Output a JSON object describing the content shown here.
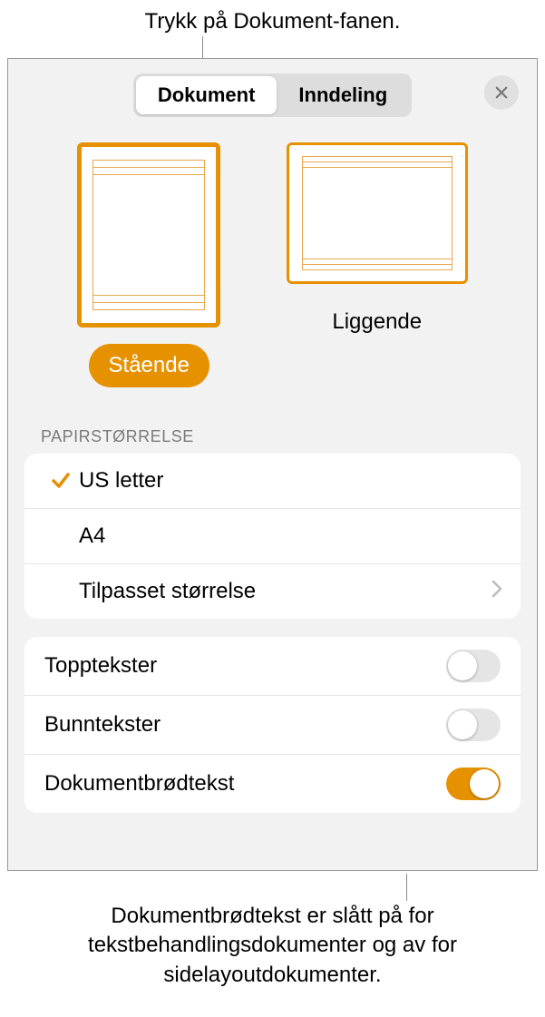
{
  "callouts": {
    "top": "Trykk på Dokument-fanen.",
    "bottom": "Dokumentbrødtekst er slått på for tekstbehandlingsdokumenter og av for sidelayoutdokumenter."
  },
  "tabs": {
    "document": "Dokument",
    "section": "Inndeling"
  },
  "orientation": {
    "portrait": "Stående",
    "landscape": "Liggende"
  },
  "paper_size": {
    "header": "PAPIRSTØRRELSE",
    "options": {
      "us_letter": "US letter",
      "a4": "A4",
      "custom": "Tilpasset størrelse"
    }
  },
  "toggles": {
    "headers": "Topptekster",
    "footers": "Bunntekster",
    "body": "Dokumentbrødtekst"
  }
}
